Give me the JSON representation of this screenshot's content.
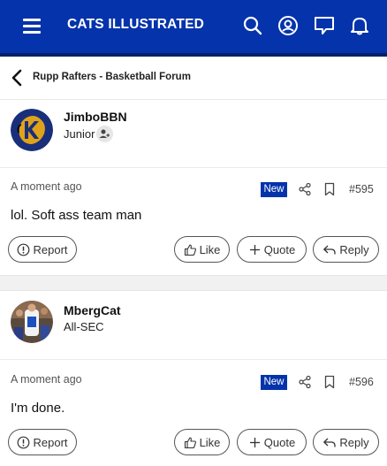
{
  "header": {
    "title": "CATS ILLUSTRATED",
    "bg_color": "#0433ab",
    "icons": [
      "menu-icon",
      "search-icon",
      "account-icon",
      "messages-icon",
      "notifications-icon"
    ]
  },
  "breadcrumb": {
    "label": "Rupp Rafters - Basketball Forum"
  },
  "posts": [
    {
      "username": "JimboBBN",
      "rank": "Junior",
      "timestamp": "A moment ago",
      "badge": "New",
      "number": "#595",
      "text": "lol. Soft ass team man",
      "actions": {
        "report": "Report",
        "like": "Like",
        "quote": "Quote",
        "reply": "Reply"
      }
    },
    {
      "username": "MbergCat",
      "rank": "All-SEC",
      "timestamp": "A moment ago",
      "badge": "New",
      "number": "#596",
      "text": "I'm done.",
      "actions": {
        "report": "Report",
        "like": "Like",
        "quote": "Quote",
        "reply": "Reply"
      }
    }
  ]
}
